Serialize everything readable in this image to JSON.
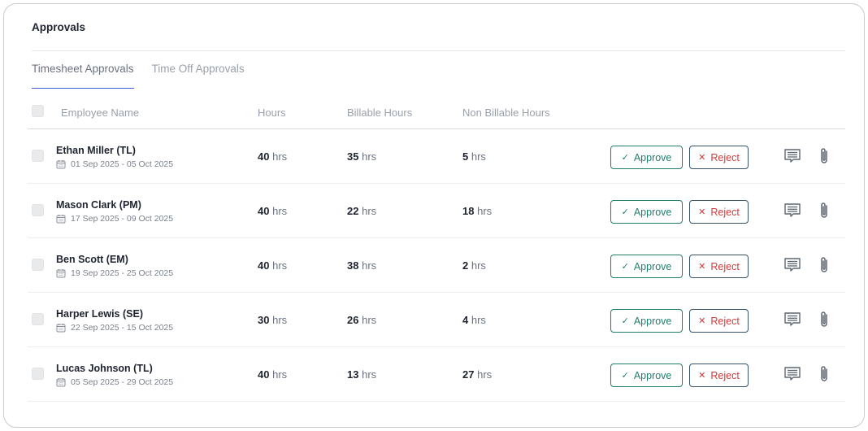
{
  "title": "Approvals",
  "tabs": [
    {
      "label": "Timesheet Approvals",
      "active": true
    },
    {
      "label": "Time Off Approvals",
      "active": false
    }
  ],
  "columns": {
    "employee": "Employee Name",
    "hours": "Hours",
    "billable": "Billable Hours",
    "non_billable": "Non Billable Hours"
  },
  "unit": "hrs",
  "actions": {
    "approve_label": "Approve",
    "reject_label": "Reject"
  },
  "icons": {
    "approve": "check-icon",
    "reject": "x-icon",
    "comment": "comment-icon",
    "attach": "paperclip-icon",
    "date": "calendar-icon"
  },
  "colors": {
    "approve": "#1f7f6f",
    "reject": "#d23a3a",
    "tab_active": "#3d5bd9"
  },
  "rows": [
    {
      "name": "Ethan Miller (TL)",
      "dates": "01 Sep 2025 - 05 Oct 2025",
      "hours": "40",
      "billable": "35",
      "non_billable": "5"
    },
    {
      "name": "Mason Clark (PM)",
      "dates": "17 Sep 2025 - 09 Oct 2025",
      "hours": "40",
      "billable": "22",
      "non_billable": "18"
    },
    {
      "name": "Ben Scott (EM)",
      "dates": "19 Sep 2025 - 25 Oct 2025",
      "hours": "40",
      "billable": "38",
      "non_billable": "2"
    },
    {
      "name": "Harper Lewis (SE)",
      "dates": "22 Sep 2025 - 15 Oct 2025",
      "hours": "30",
      "billable": "26",
      "non_billable": "4"
    },
    {
      "name": "Lucas Johnson (TL)",
      "dates": "05 Sep 2025 - 29 Oct 2025",
      "hours": "40",
      "billable": "13",
      "non_billable": "27"
    }
  ]
}
